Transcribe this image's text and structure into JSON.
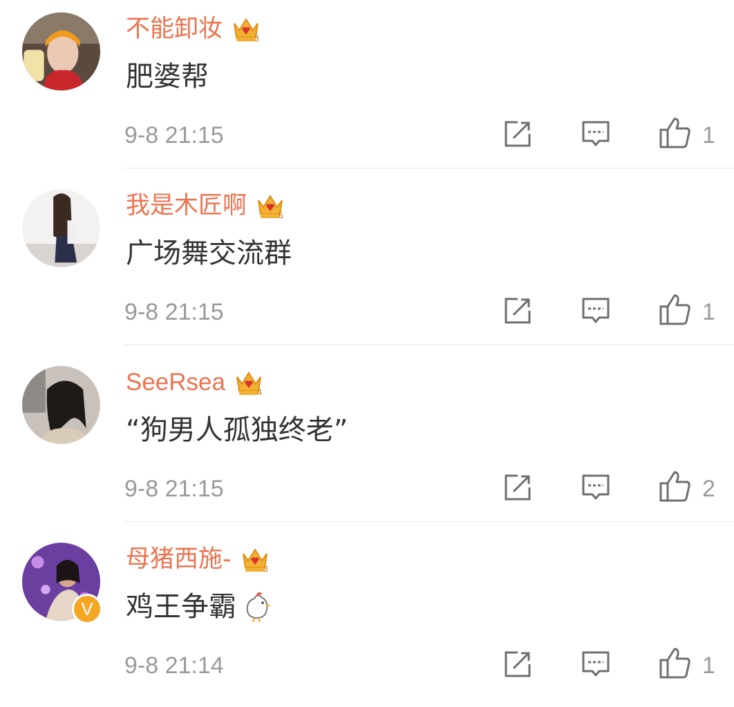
{
  "comments": [
    {
      "username": "不能卸妆",
      "level": "3",
      "text": "肥婆帮",
      "time": "9-8 21:15",
      "likes": "1",
      "verified": false
    },
    {
      "username": "我是木匠啊",
      "level": "5",
      "text": "广场舞交流群",
      "time": "9-8 21:15",
      "likes": "1",
      "verified": false
    },
    {
      "username": "SeeRsea",
      "level": "4",
      "text": "“狗男人孤独终老”",
      "time": "9-8 21:15",
      "likes": "2",
      "verified": false
    },
    {
      "username": "母猪西施-",
      "level": "3",
      "text": "鸡王争霸",
      "time": "9-8 21:14",
      "likes": "1",
      "verified": true,
      "emoji": "chick-emoji"
    }
  ],
  "badge": {
    "verified_mark": "V"
  },
  "icons": {
    "share": "share-icon",
    "reply": "comment-icon",
    "like": "thumbs-up-icon",
    "crown": "vip-crown-icon"
  },
  "colors": {
    "username": "#eb7350",
    "meta": "#9a9a9a",
    "text": "#333333",
    "crown": "#f2b134",
    "badge": "#f5a623"
  }
}
